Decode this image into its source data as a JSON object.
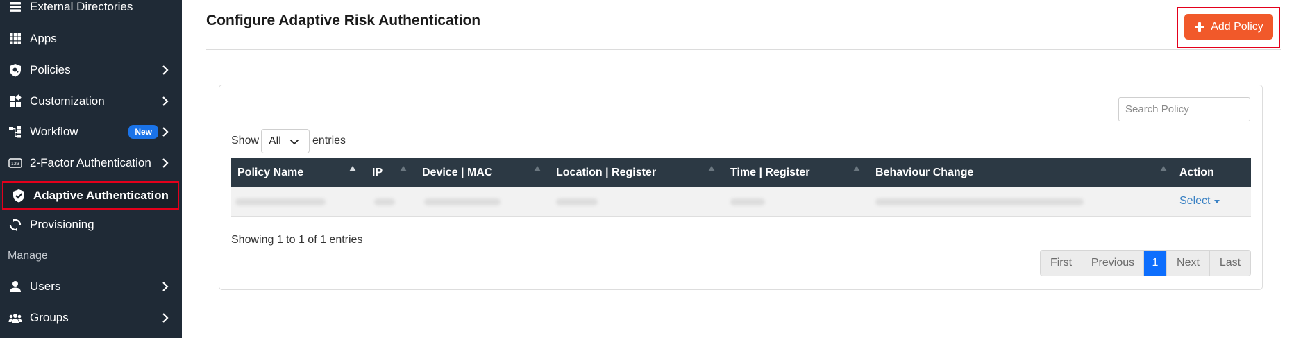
{
  "sidebar": {
    "items": [
      {
        "label": "External Directories",
        "icon": "directory-icon",
        "chevron": false
      },
      {
        "label": "Apps",
        "icon": "grid-icon",
        "chevron": false
      },
      {
        "label": "Policies",
        "icon": "policy-shield-icon",
        "chevron": true
      },
      {
        "label": "Customization",
        "icon": "customization-icon",
        "chevron": true
      },
      {
        "label": "Workflow",
        "icon": "workflow-icon",
        "chevron": true,
        "badge": "New"
      },
      {
        "label": "2-Factor Authentication",
        "icon": "two-factor-icon",
        "chevron": true
      },
      {
        "label": "Adaptive Authentication",
        "icon": "shield-check-icon",
        "chevron": false,
        "active": true
      },
      {
        "label": "Provisioning",
        "icon": "sync-icon",
        "chevron": false
      }
    ],
    "section_label": "Manage",
    "manage_items": [
      {
        "label": "Users",
        "icon": "user-icon",
        "chevron": true
      },
      {
        "label": "Groups",
        "icon": "groups-icon",
        "chevron": true
      }
    ]
  },
  "page": {
    "title": "Configure Adaptive Risk Authentication",
    "add_button_label": "Add Policy"
  },
  "table": {
    "search_placeholder": "Search Policy",
    "show_label": "Show",
    "show_value": "All",
    "entries_label": "entries",
    "columns": [
      "Policy Name",
      "IP",
      "Device | MAC",
      "Location | Register",
      "Time | Register",
      "Behaviour Change",
      "Action"
    ],
    "row_action": "Select",
    "info": "Showing 1 to 1 of 1 entries"
  },
  "pagination": {
    "buttons": [
      "First",
      "Previous",
      "1",
      "Next",
      "Last"
    ],
    "current": "1"
  },
  "colors": {
    "sidebar_bg": "#1f2a36",
    "accent_orange": "#f1592a",
    "highlight_red": "#e3001b",
    "table_header": "#2c3944",
    "page_blue": "#0d6efd",
    "badge_blue": "#1a73e8"
  }
}
